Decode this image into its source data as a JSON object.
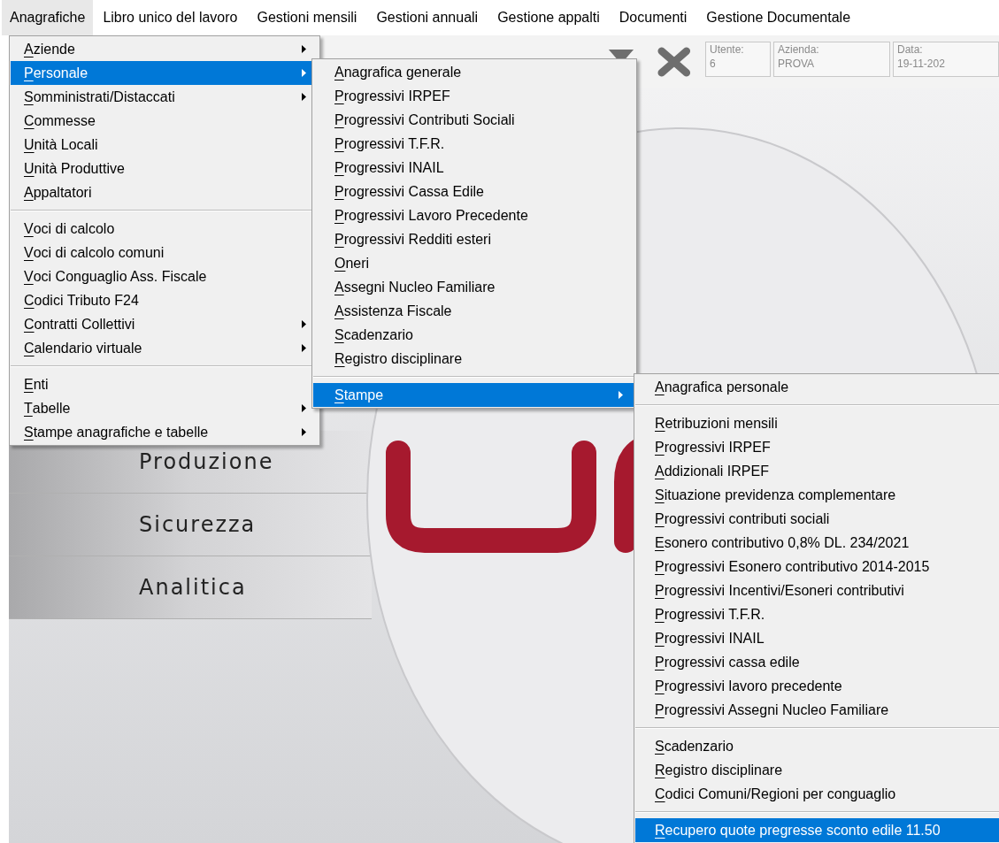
{
  "menu_bar": [
    {
      "label": "Anagrafiche",
      "selected": true
    },
    {
      "label": "Libro unico del lavoro",
      "selected": false
    },
    {
      "label": "Gestioni mensili",
      "selected": false
    },
    {
      "label": "Gestioni annuali",
      "selected": false
    },
    {
      "label": "Gestione appalti",
      "selected": false
    },
    {
      "label": "Documenti",
      "selected": false
    },
    {
      "label": "Gestione Documentale",
      "selected": false
    }
  ],
  "toolbar": {
    "info_fields": [
      {
        "label": "Utente:",
        "value": "6"
      },
      {
        "label": "Azienda:",
        "value": "PROVA"
      },
      {
        "label": "Data:",
        "value": "19-11-202"
      }
    ]
  },
  "side_nav": [
    "Produzione",
    "Sicurezza",
    "Analitica"
  ],
  "menus": [
    {
      "groups": [
        [
          {
            "label": "Aziende",
            "submenu": true,
            "selected": false
          },
          {
            "label": "Personale",
            "submenu": true,
            "selected": true
          },
          {
            "label": "Somministrati/Distaccati",
            "submenu": true,
            "selected": false
          },
          {
            "label": "Commesse",
            "submenu": false,
            "selected": false
          },
          {
            "label": "Unità Locali",
            "submenu": false,
            "selected": false
          },
          {
            "label": "Unità Produttive",
            "submenu": false,
            "selected": false
          },
          {
            "label": "Appaltatori",
            "submenu": false,
            "selected": false
          }
        ],
        [
          {
            "label": "Voci di calcolo",
            "submenu": false,
            "selected": false
          },
          {
            "label": "Voci di calcolo comuni",
            "submenu": false,
            "selected": false
          },
          {
            "label": "Voci Conguaglio Ass. Fiscale",
            "submenu": false,
            "selected": false
          },
          {
            "label": "Codici Tributo F24",
            "submenu": false,
            "selected": false
          },
          {
            "label": "Contratti Collettivi",
            "submenu": true,
            "selected": false
          },
          {
            "label": "Calendario virtuale",
            "submenu": true,
            "selected": false
          }
        ],
        [
          {
            "label": "Enti",
            "submenu": false,
            "selected": false
          },
          {
            "label": "Tabelle",
            "submenu": true,
            "selected": false
          },
          {
            "label": "Stampe anagrafiche e tabelle",
            "submenu": true,
            "selected": false
          }
        ]
      ]
    },
    {
      "groups": [
        [
          {
            "label": "Anagrafica generale",
            "submenu": false,
            "selected": false
          },
          {
            "label": "Progressivi IRPEF",
            "submenu": false,
            "selected": false
          },
          {
            "label": "Progressivi Contributi Sociali",
            "submenu": false,
            "selected": false
          },
          {
            "label": "Progressivi T.F.R.",
            "submenu": false,
            "selected": false
          },
          {
            "label": "Progressivi INAIL",
            "submenu": false,
            "selected": false
          },
          {
            "label": "Progressivi Cassa Edile",
            "submenu": false,
            "selected": false
          },
          {
            "label": "Progressivi Lavoro Precedente",
            "submenu": false,
            "selected": false
          },
          {
            "label": "Progressivi Redditi esteri",
            "submenu": false,
            "selected": false
          },
          {
            "label": "Oneri",
            "submenu": false,
            "selected": false
          },
          {
            "label": "Assegni Nucleo Familiare",
            "submenu": false,
            "selected": false
          },
          {
            "label": "Assistenza Fiscale",
            "submenu": false,
            "selected": false
          },
          {
            "label": "Scadenzario",
            "submenu": false,
            "selected": false
          },
          {
            "label": "Registro disciplinare",
            "submenu": false,
            "selected": false
          }
        ],
        [
          {
            "label": "Stampe",
            "submenu": true,
            "selected": true
          }
        ]
      ]
    },
    {
      "groups": [
        [
          {
            "label": "Anagrafica personale",
            "submenu": false,
            "selected": false
          }
        ],
        [
          {
            "label": "Retribuzioni mensili",
            "submenu": false,
            "selected": false
          },
          {
            "label": "Progressivi IRPEF",
            "submenu": false,
            "selected": false
          },
          {
            "label": "Addizionali IRPEF",
            "submenu": false,
            "selected": false
          },
          {
            "label": "Situazione previdenza complementare",
            "submenu": false,
            "selected": false
          },
          {
            "label": "Progressivi contributi sociali",
            "submenu": false,
            "selected": false
          },
          {
            "label": "Esonero contributivo 0,8% DL. 234/2021",
            "submenu": false,
            "selected": false
          },
          {
            "label": "Progressivi Esonero contributivo 2014-2015",
            "submenu": false,
            "selected": false
          },
          {
            "label": "Progressivi Incentivi/Esoneri contributivi",
            "submenu": false,
            "selected": false
          },
          {
            "label": "Progressivi T.F.R.",
            "submenu": false,
            "selected": false
          },
          {
            "label": "Progressivi INAIL",
            "submenu": false,
            "selected": false
          },
          {
            "label": "Progressivi cassa edile",
            "submenu": false,
            "selected": false
          },
          {
            "label": "Progressivi lavoro precedente",
            "submenu": false,
            "selected": false
          },
          {
            "label": "Progressivi Assegni Nucleo Familiare",
            "submenu": false,
            "selected": false
          }
        ],
        [
          {
            "label": "Scadenzario",
            "submenu": false,
            "selected": false
          },
          {
            "label": "Registro disciplinare",
            "submenu": false,
            "selected": false
          },
          {
            "label": "Codici Comuni/Regioni per conguaglio",
            "submenu": false,
            "selected": false
          }
        ],
        [
          {
            "label": "Recupero quote pregresse sconto edile 11.50",
            "submenu": false,
            "selected": true
          }
        ]
      ]
    }
  ]
}
